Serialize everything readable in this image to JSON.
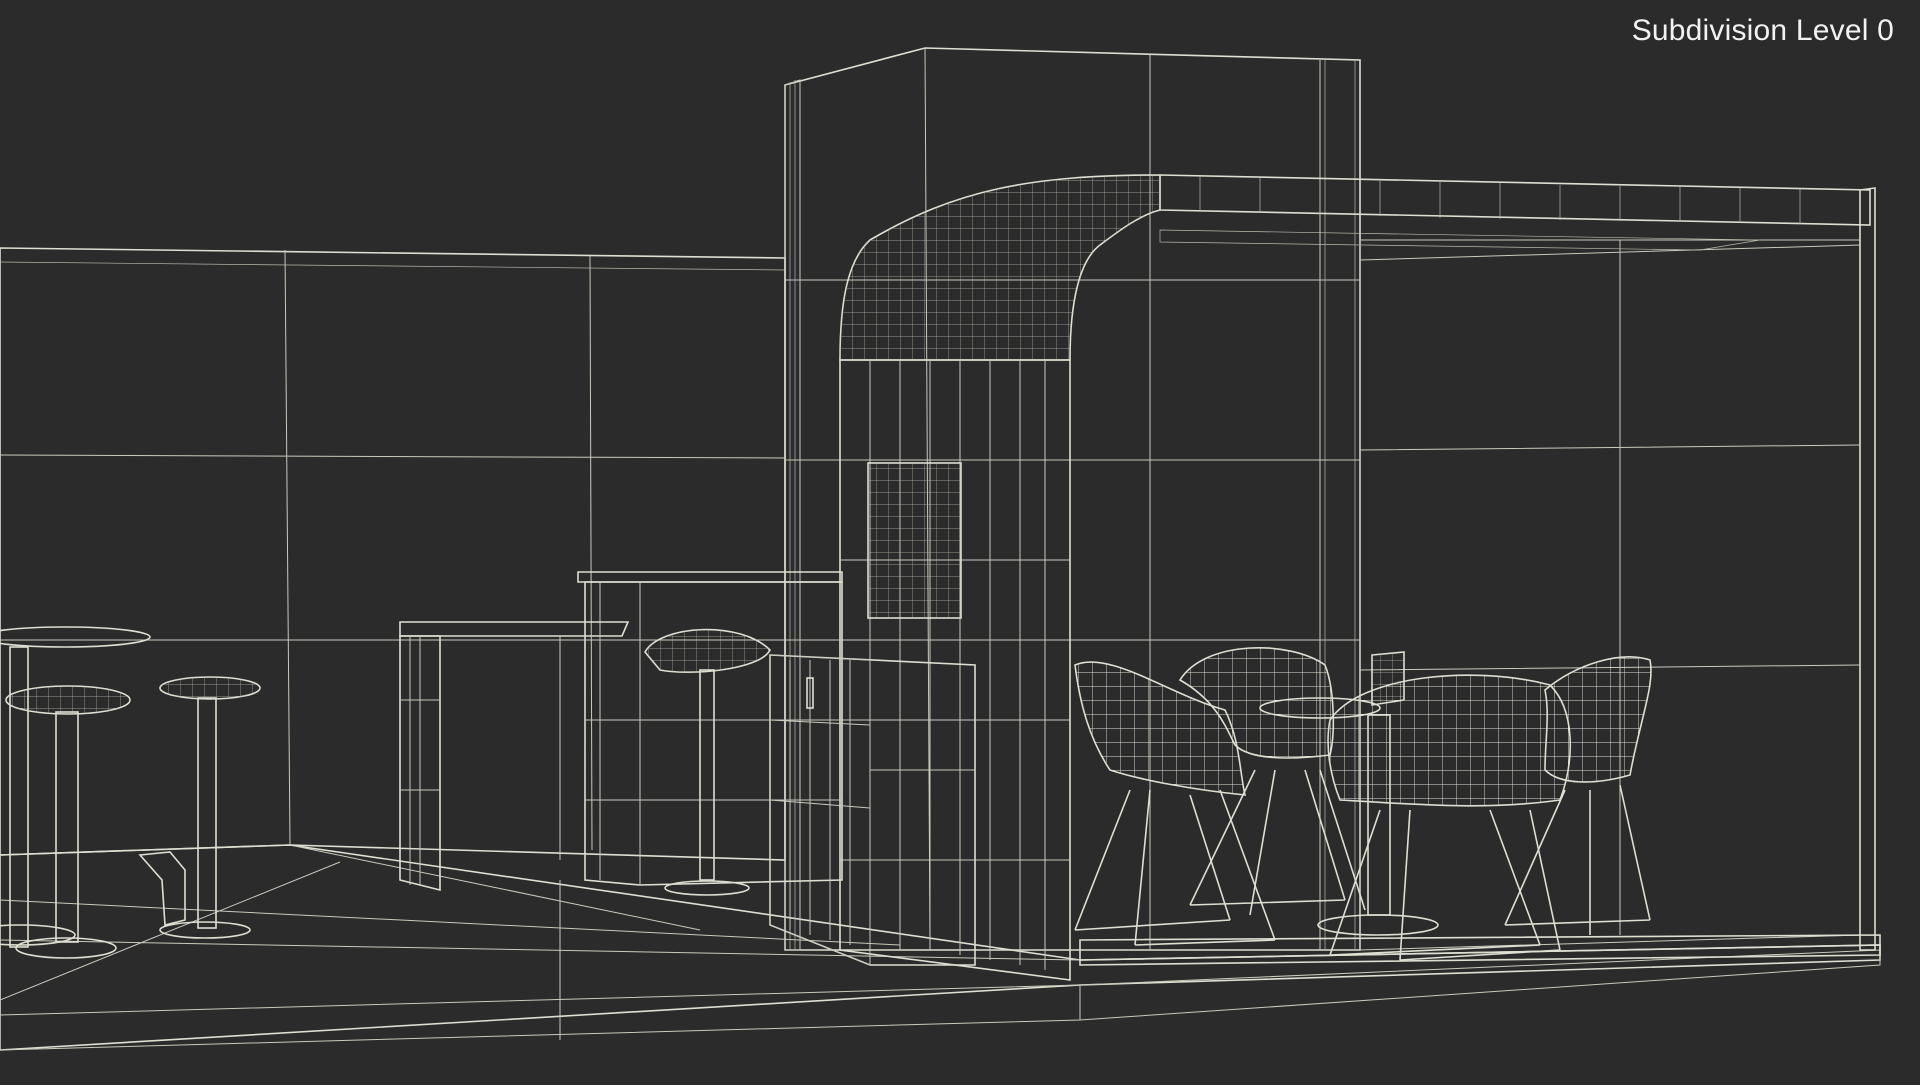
{
  "overlay": {
    "subdivision_label": "Subdivision Level 0"
  },
  "colors": {
    "background": "#2b2b2b",
    "wireframe": "#d8d8cc",
    "surface": "#5d5d57",
    "overlay_text": "#f2f2f2"
  },
  "scene": {
    "objects": [
      "exhibition-booth",
      "back-wall",
      "curved-canopy",
      "bar-counter",
      "side-table",
      "storage-cabinet",
      "wall-panel",
      "bar-stool",
      "round-bar-table",
      "armchair",
      "round-table",
      "laptop",
      "floor-platform"
    ]
  }
}
